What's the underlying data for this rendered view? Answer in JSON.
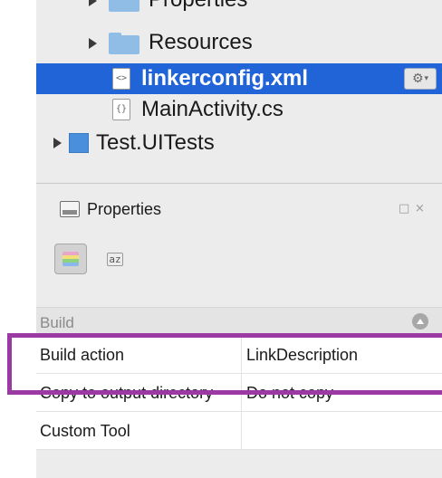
{
  "solution_tree": {
    "items": [
      {
        "label": "Properties",
        "icon": "folder-icon",
        "expandable": true
      },
      {
        "label": "Resources",
        "icon": "folder-icon",
        "expandable": true
      },
      {
        "label": "linkerconfig.xml",
        "icon": "xml-file-icon",
        "selected": true,
        "icon_glyph": "<>"
      },
      {
        "label": "MainActivity.cs",
        "icon": "cs-file-icon",
        "icon_glyph": "{}"
      },
      {
        "label": "Test.UITests",
        "icon": "project-icon",
        "expandable": true
      }
    ],
    "gear_icon": "⚙",
    "gear_caret": "▾",
    "selection_color": "#2164d8"
  },
  "properties_pad": {
    "title": "Properties",
    "maximize_icon": "□",
    "close_icon": "×",
    "toolbar": {
      "categorize_icon_colors": [
        "#e8a6c8",
        "#f4e07a",
        "#8fd27e",
        "#8ab8ec"
      ],
      "sort_icon_text": "az"
    },
    "category": "Build",
    "rows": [
      {
        "name": "Build action",
        "value": "LinkDescription"
      },
      {
        "name": "Copy to output directory",
        "value": "Do not copy"
      },
      {
        "name": "Custom Tool",
        "value": ""
      }
    ]
  },
  "highlight_color": "#9b3aa3"
}
